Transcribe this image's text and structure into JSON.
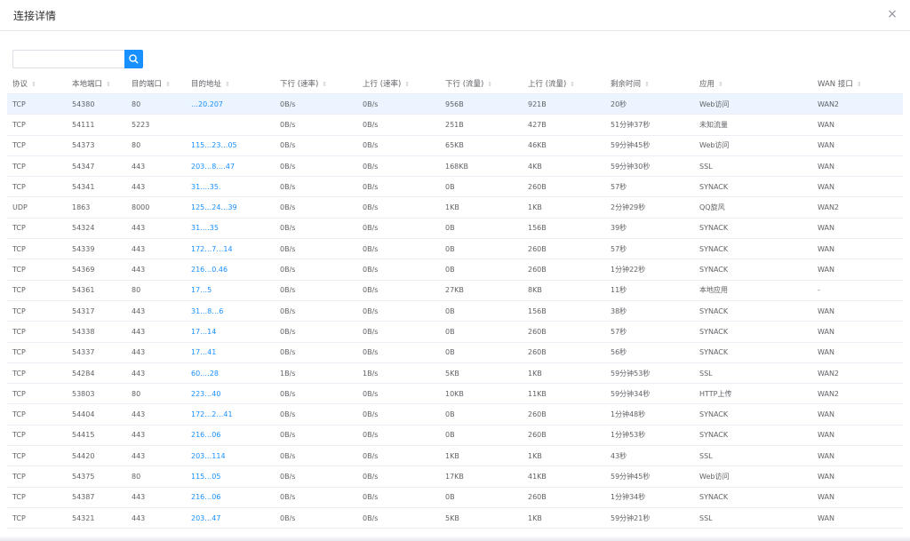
{
  "dialog": {
    "title": "连接详情",
    "close_glyph": "×"
  },
  "search": {
    "placeholder": "",
    "icon": "search-icon"
  },
  "colors": {
    "accent": "#1890ff",
    "row_highlight": "#ecf5ff"
  },
  "table": {
    "columns": [
      "协议",
      "本地端口",
      "目的端口",
      "目的地址",
      "下行 (速率)",
      "上行 (速率)",
      "下行 (流量)",
      "上行 (流量)",
      "剩余时间",
      "应用",
      "WAN 接口"
    ],
    "rows": [
      [
        "TCP",
        "54380",
        "80",
        "…20.207",
        "0B/s",
        "0B/s",
        "956B",
        "921B",
        "20秒",
        "Web访问",
        "WAN2"
      ],
      [
        "TCP",
        "54111",
        "5223",
        "",
        "0B/s",
        "0B/s",
        "251B",
        "427B",
        "51分钟37秒",
        "未知流量",
        "WAN"
      ],
      [
        "TCP",
        "54373",
        "80",
        "115…23…05",
        "0B/s",
        "0B/s",
        "65KB",
        "46KB",
        "59分钟45秒",
        "Web访问",
        "WAN"
      ],
      [
        "TCP",
        "54347",
        "443",
        "203…8.…47",
        "0B/s",
        "0B/s",
        "168KB",
        "4KB",
        "59分钟30秒",
        "SSL",
        "WAN"
      ],
      [
        "TCP",
        "54341",
        "443",
        "31.…35.",
        "0B/s",
        "0B/s",
        "0B",
        "260B",
        "57秒",
        "SYNACK",
        "WAN"
      ],
      [
        "UDP",
        "1863",
        "8000",
        "125…24…39",
        "0B/s",
        "0B/s",
        "1KB",
        "1KB",
        "2分钟29秒",
        "QQ旋风",
        "WAN2"
      ],
      [
        "TCP",
        "54324",
        "443",
        "31.…35",
        "0B/s",
        "0B/s",
        "0B",
        "156B",
        "39秒",
        "SYNACK",
        "WAN"
      ],
      [
        "TCP",
        "54339",
        "443",
        "172…7…14",
        "0B/s",
        "0B/s",
        "0B",
        "260B",
        "57秒",
        "SYNACK",
        "WAN"
      ],
      [
        "TCP",
        "54369",
        "443",
        "216…0.46",
        "0B/s",
        "0B/s",
        "0B",
        "260B",
        "1分钟22秒",
        "SYNACK",
        "WAN"
      ],
      [
        "TCP",
        "54361",
        "80",
        "17…5",
        "0B/s",
        "0B/s",
        "27KB",
        "8KB",
        "11秒",
        "本地应用",
        "-"
      ],
      [
        "TCP",
        "54317",
        "443",
        "31…8…6",
        "0B/s",
        "0B/s",
        "0B",
        "156B",
        "38秒",
        "SYNACK",
        "WAN"
      ],
      [
        "TCP",
        "54338",
        "443",
        "17…14",
        "0B/s",
        "0B/s",
        "0B",
        "260B",
        "57秒",
        "SYNACK",
        "WAN"
      ],
      [
        "TCP",
        "54337",
        "443",
        "17…41",
        "0B/s",
        "0B/s",
        "0B",
        "260B",
        "56秒",
        "SYNACK",
        "WAN"
      ],
      [
        "TCP",
        "54284",
        "443",
        "60.…28",
        "1B/s",
        "1B/s",
        "5KB",
        "1KB",
        "59分钟53秒",
        "SSL",
        "WAN2"
      ],
      [
        "TCP",
        "53803",
        "80",
        "223…40",
        "0B/s",
        "0B/s",
        "10KB",
        "11KB",
        "59分钟34秒",
        "HTTP上传",
        "WAN2"
      ],
      [
        "TCP",
        "54404",
        "443",
        "172…2…41",
        "0B/s",
        "0B/s",
        "0B",
        "260B",
        "1分钟48秒",
        "SYNACK",
        "WAN"
      ],
      [
        "TCP",
        "54415",
        "443",
        "216…06",
        "0B/s",
        "0B/s",
        "0B",
        "260B",
        "1分钟53秒",
        "SYNACK",
        "WAN"
      ],
      [
        "TCP",
        "54420",
        "443",
        "203…114",
        "0B/s",
        "0B/s",
        "1KB",
        "1KB",
        "43秒",
        "SSL",
        "WAN"
      ],
      [
        "TCP",
        "54375",
        "80",
        "115…05",
        "0B/s",
        "0B/s",
        "17KB",
        "41KB",
        "59分钟45秒",
        "Web访问",
        "WAN"
      ],
      [
        "TCP",
        "54387",
        "443",
        "216…06",
        "0B/s",
        "0B/s",
        "0B",
        "260B",
        "1分钟34秒",
        "SYNACK",
        "WAN"
      ],
      [
        "TCP",
        "54321",
        "443",
        "203…47",
        "0B/s",
        "0B/s",
        "5KB",
        "1KB",
        "59分钟21秒",
        "SSL",
        "WAN"
      ]
    ]
  }
}
